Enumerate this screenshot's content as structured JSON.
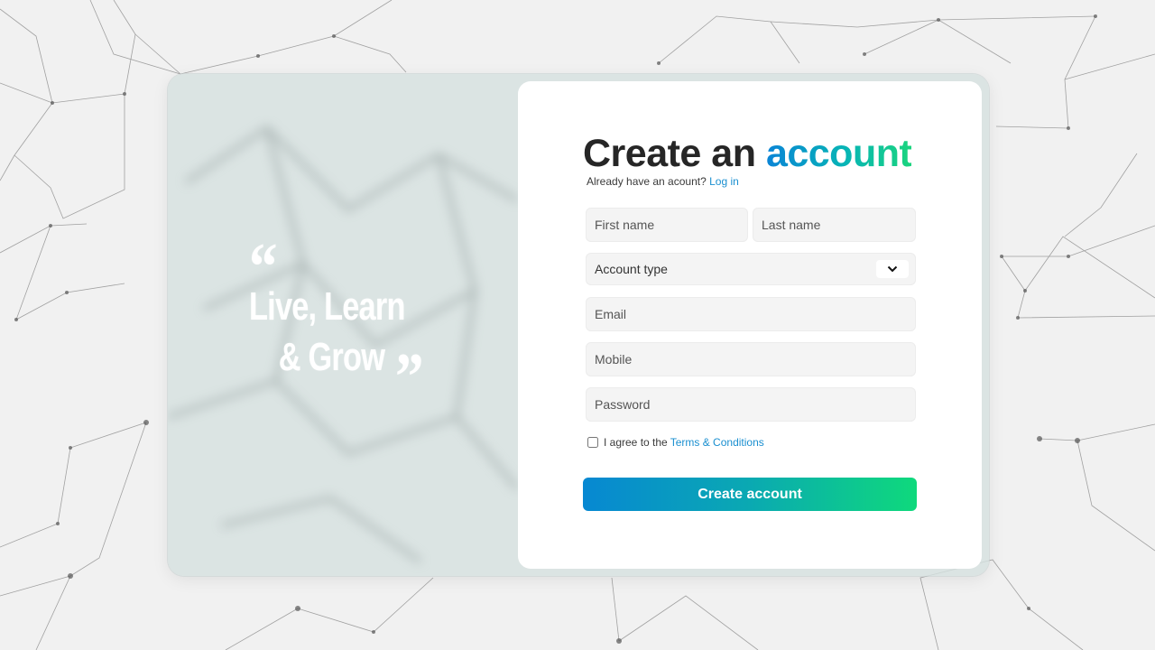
{
  "quote": {
    "open_mark": "“",
    "line1": "Live, Learn",
    "line2": "& Grow",
    "close_mark": "”"
  },
  "form": {
    "title_main": "Create an ",
    "title_accent": "account",
    "subtitle_text": "Already have an acount?",
    "login_link": "Log in",
    "first_name_placeholder": "First name",
    "last_name_placeholder": "Last name",
    "account_type_value": "Account type",
    "email_placeholder": "Email",
    "mobile_placeholder": "Mobile",
    "password_placeholder": "Password",
    "agree_text": "I agree to the",
    "terms_link": "Terms & Conditions",
    "submit_label": "Create account"
  },
  "icons": {
    "select_arrow": "chevron-down-icon"
  },
  "colors": {
    "accent_blue": "#0a84d6",
    "accent_green": "#1bd47e",
    "link": "#1a8fd0",
    "panel_bg": "#ffffff",
    "card_bg": "#d6e0df"
  }
}
